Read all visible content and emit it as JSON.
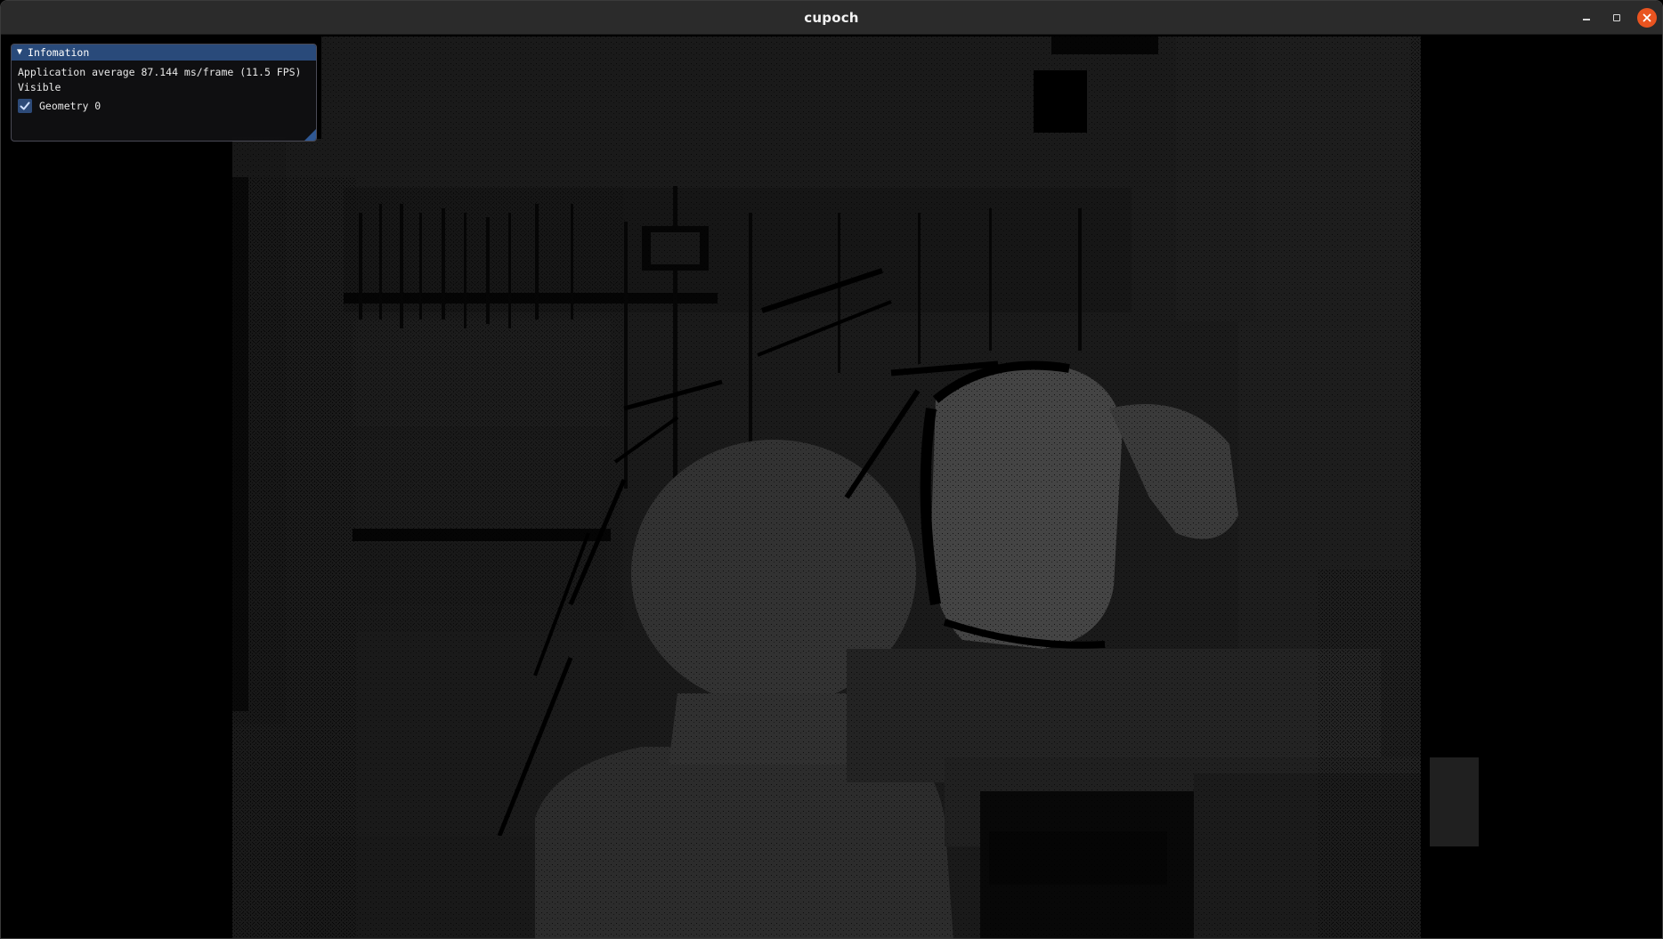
{
  "window": {
    "title": "cupoch",
    "controls": {
      "minimize_icon": "minimize-icon",
      "maximize_icon": "restore-icon",
      "close_icon": "close-icon"
    },
    "close_color": "#e95420"
  },
  "info_panel": {
    "title": "Infomation",
    "collapse_icon": "triangle-down-icon",
    "fps_text": "Application average 87.144 ms/frame (11.5 FPS)",
    "visible_label": "Visible",
    "geometries": [
      {
        "label": "Geometry 0",
        "checked": true
      }
    ],
    "header_color": "#294a7a",
    "checkbox_color": "#2d4a78"
  },
  "viewport": {
    "description_icon": "depth-image",
    "background_color": "#000000"
  }
}
